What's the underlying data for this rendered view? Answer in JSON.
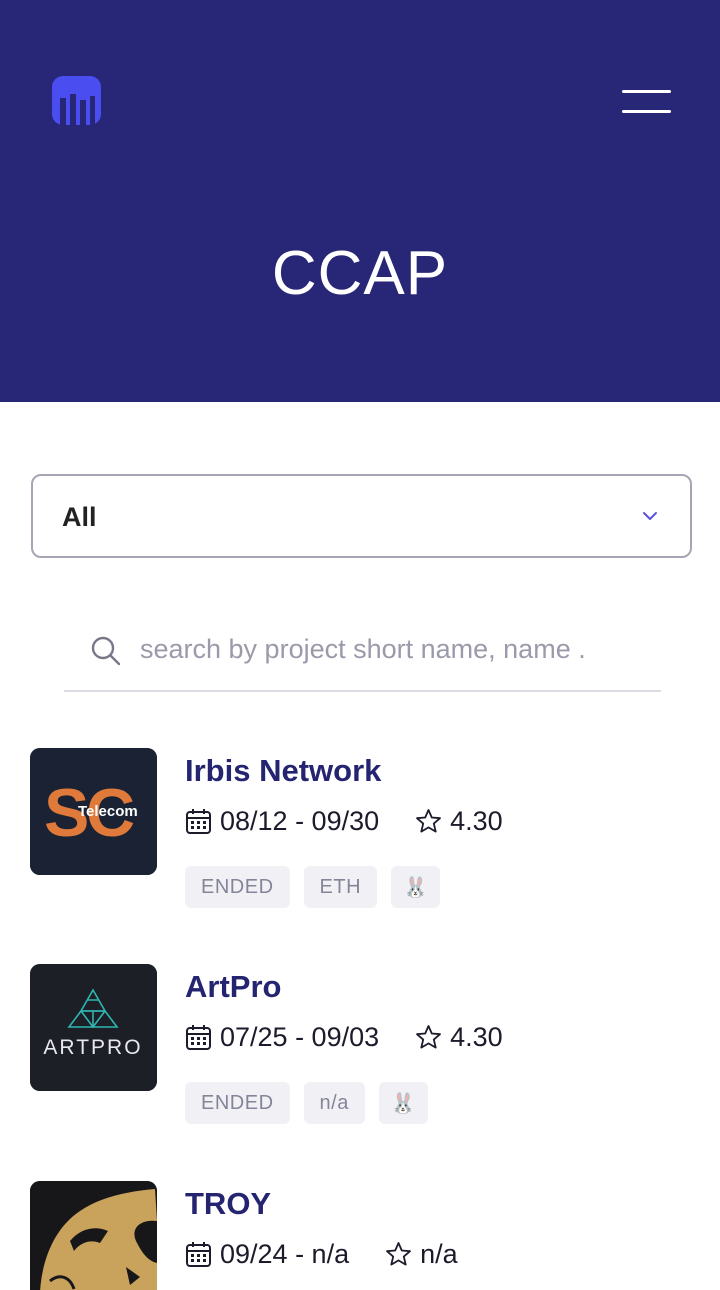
{
  "header": {
    "title": "CCAP",
    "logo_icon": "bar-chart-logo-icon",
    "menu_icon": "hamburger-menu-icon",
    "background": "#282676"
  },
  "filter": {
    "selected": "All"
  },
  "search": {
    "placeholder": "search by project short name, name ."
  },
  "projects": [
    {
      "name": "Irbis Network",
      "dates": "08/12 - 09/30",
      "rating": "4.30",
      "tags": [
        "ENDED",
        "ETH",
        "🐰"
      ],
      "logo_text": "Telecom"
    },
    {
      "name": "ArtPro",
      "dates": "07/25 - 09/03",
      "rating": "4.30",
      "tags": [
        "ENDED",
        "n/a",
        "🐰"
      ],
      "logo_text": "ARTPRO"
    },
    {
      "name": "TROY",
      "dates": "09/24 - n/a",
      "rating": "n/a",
      "tags": []
    }
  ]
}
